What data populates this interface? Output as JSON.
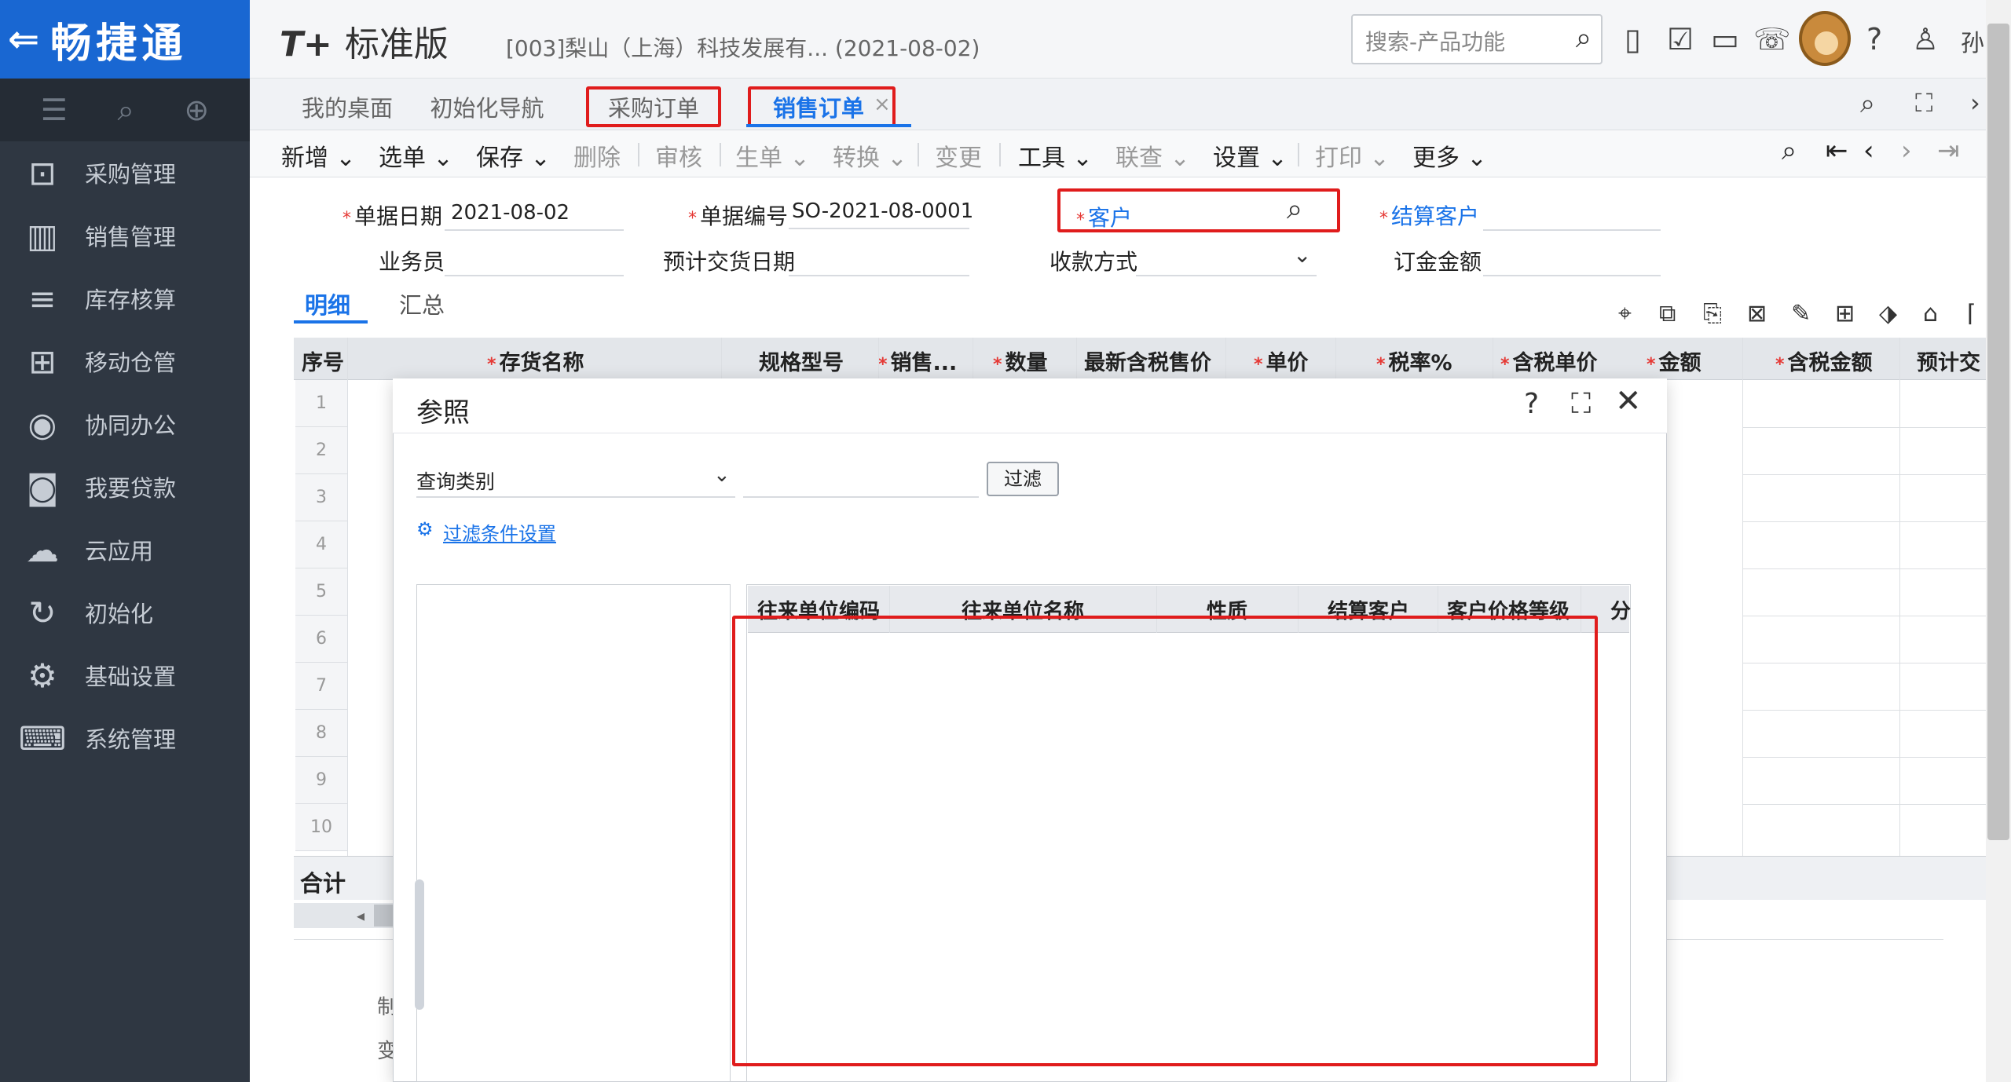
{
  "app": {
    "logo": "畅捷通",
    "product_name": "标准版",
    "product_prefix": "T+",
    "company": "[003]梨山（上海）科技发展有...  (2021-08-02)",
    "search_placeholder": "搜索-产品功能",
    "username": "孙"
  },
  "sidebar": {
    "items": [
      {
        "label": "采购管理",
        "icon": "purchase-icon"
      },
      {
        "label": "销售管理",
        "icon": "sales-chart-icon"
      },
      {
        "label": "库存核算",
        "icon": "inventory-icon"
      },
      {
        "label": "移动仓管",
        "icon": "mobile-warehouse-icon"
      },
      {
        "label": "协同办公",
        "icon": "collaboration-icon"
      },
      {
        "label": "我要贷款",
        "icon": "loan-icon"
      },
      {
        "label": "云应用",
        "icon": "cloud-icon"
      },
      {
        "label": "初始化",
        "icon": "init-icon"
      },
      {
        "label": "基础设置",
        "icon": "settings-icon"
      },
      {
        "label": "系统管理",
        "icon": "system-icon"
      }
    ]
  },
  "tabs": [
    {
      "label": "我的桌面"
    },
    {
      "label": "初始化导航"
    },
    {
      "label": "采购订单"
    },
    {
      "label": "销售订单"
    }
  ],
  "toolbar": {
    "items": [
      "新增",
      "选单",
      "保存",
      "删除",
      "审核",
      "生单",
      "转换",
      "变更",
      "工具",
      "联查",
      "设置",
      "打印",
      "更多"
    ]
  },
  "form": {
    "date_label": "单据日期",
    "date_value": "2021-08-02",
    "code_label": "单据编号",
    "code_value": "SO-2021-08-0001",
    "customer_label": "客户",
    "settle_label": "结算客户",
    "salesman_label": "业务员",
    "delivery_label": "预计交货日期",
    "payment_label": "收款方式",
    "deposit_label": "订金金额",
    "detail_tab": "明细",
    "summary_tab": "汇总"
  },
  "grid": {
    "columns": [
      "序号",
      "存货名称",
      "规格型号",
      "销售...",
      "数量",
      "最新含税售价",
      "单价",
      "税率%",
      "含税单价",
      "金额",
      "含税金额",
      "预计交"
    ],
    "rows": [
      "1",
      "2",
      "3",
      "4",
      "5",
      "6",
      "7",
      "8",
      "9",
      "10"
    ],
    "total_label": "合计"
  },
  "footer": {
    "maker": "制",
    "changer": "变"
  },
  "modal": {
    "title": "参照",
    "query_label": "查询类别",
    "filter_button": "过滤",
    "filter_settings": "过滤条件设置",
    "columns": [
      "往来单位编码",
      "往来单位名称",
      "性质",
      "结算客户",
      "客户价格等级",
      "分"
    ]
  }
}
